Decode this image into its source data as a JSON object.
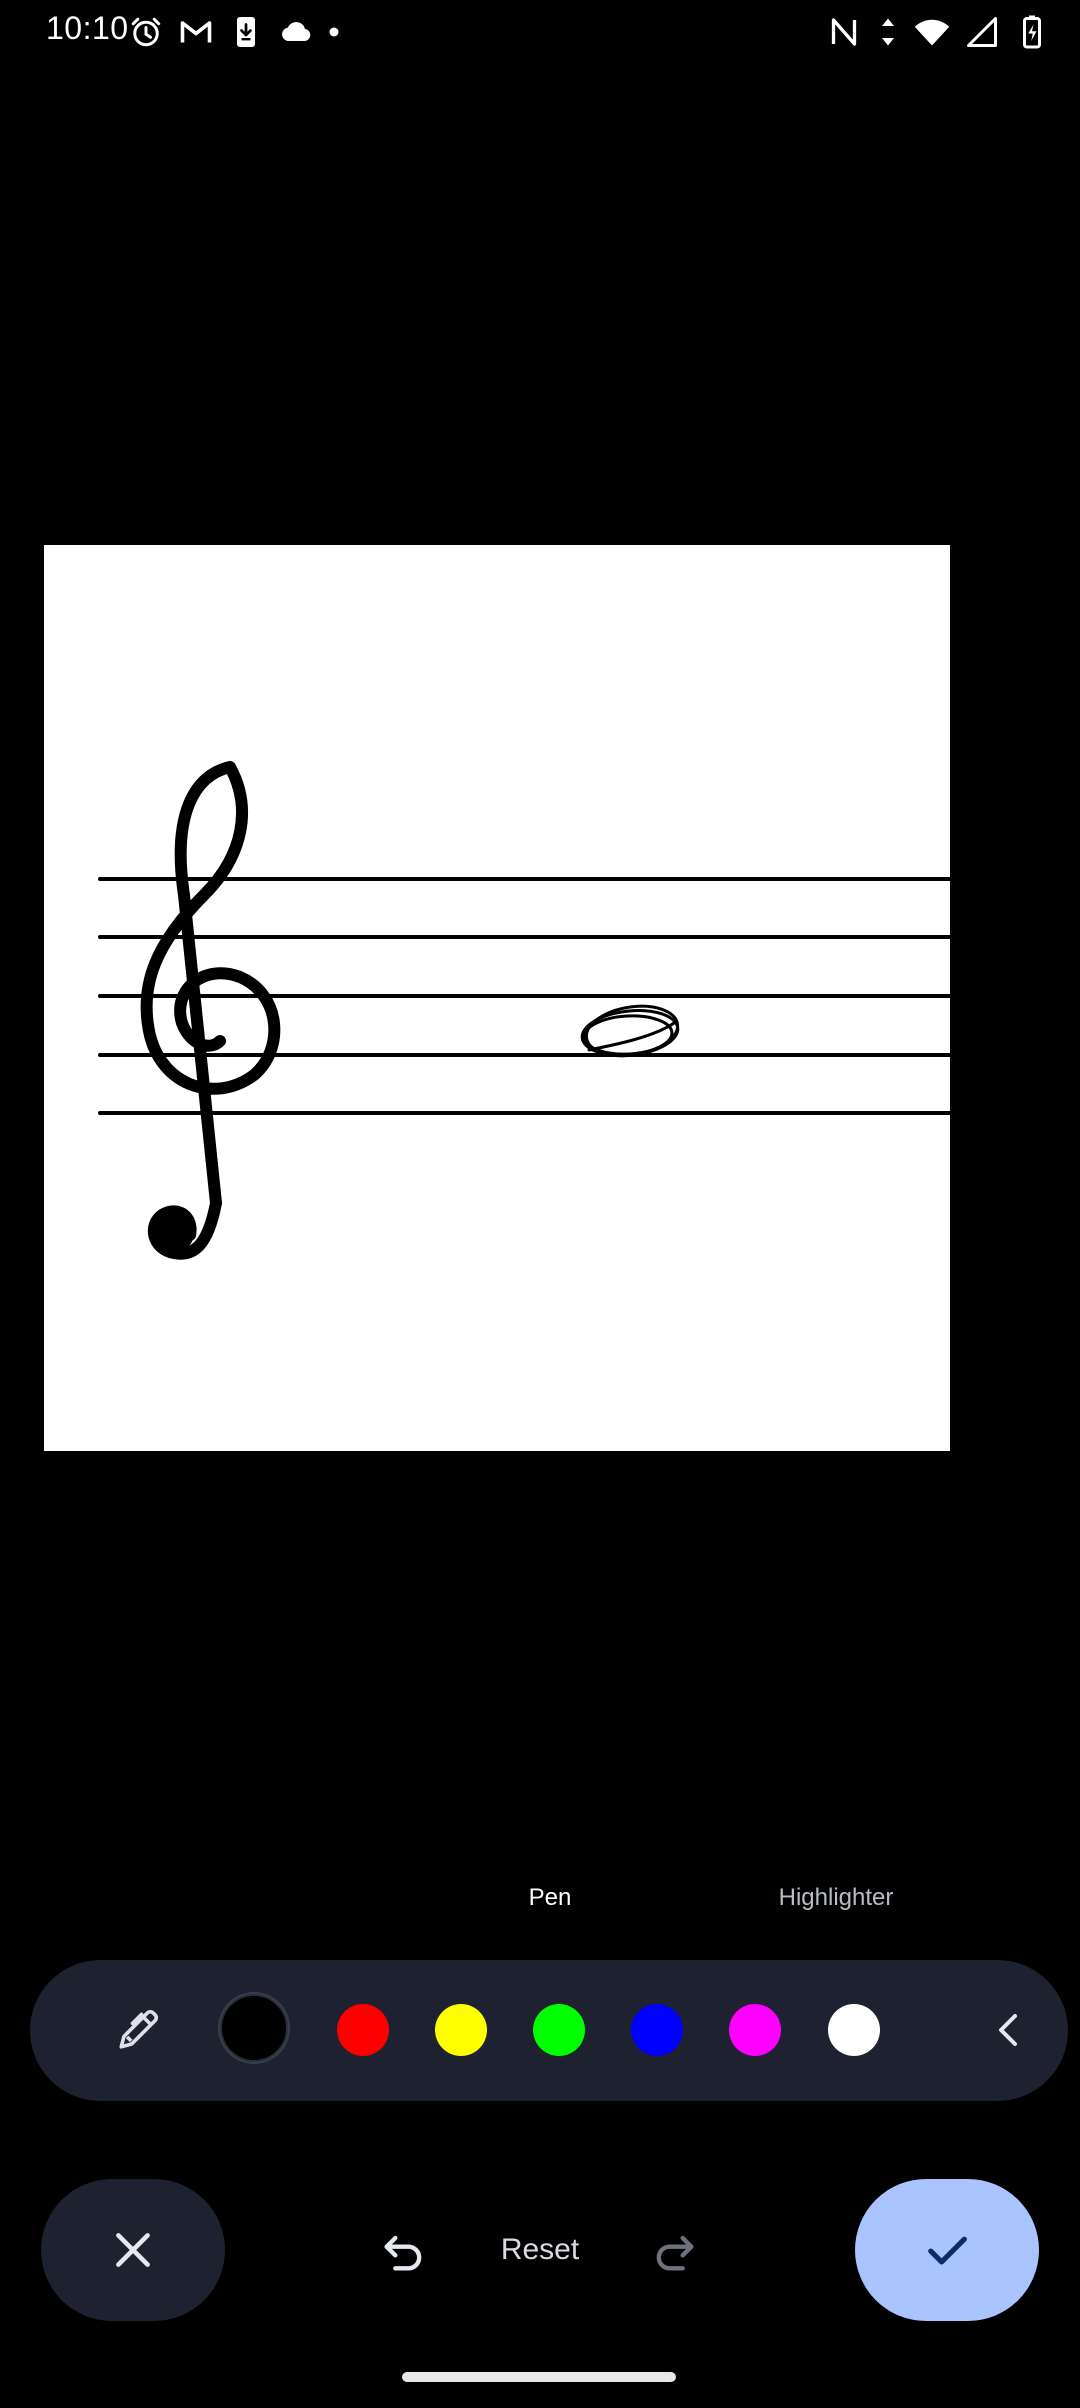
{
  "status_bar": {
    "time": "10:10",
    "left_icons": [
      "alarm-icon",
      "gmail-icon",
      "download-icon",
      "cloud-icon",
      "dot-icon"
    ],
    "right_icons": [
      "nfc-icon",
      "data-arrows-icon",
      "wifi-icon",
      "signal-icon",
      "battery-charging-icon"
    ]
  },
  "canvas": {
    "background": "#ffffff",
    "content": [
      "treble-clef-icon",
      "staff-lines",
      "hand-drawn-note"
    ]
  },
  "tool_modes": {
    "pen_label": "Pen",
    "highlighter_label": "Highlighter",
    "selected": "Pen"
  },
  "palette": {
    "tool_icon": "pen-icon",
    "colors": [
      {
        "name": "black",
        "hex": "#000000",
        "selected": true
      },
      {
        "name": "red",
        "hex": "#ff0000",
        "selected": false
      },
      {
        "name": "yellow",
        "hex": "#ffff00",
        "selected": false
      },
      {
        "name": "green",
        "hex": "#00ff00",
        "selected": false
      },
      {
        "name": "blue",
        "hex": "#0000ff",
        "selected": false
      },
      {
        "name": "magenta",
        "hex": "#ff00ff",
        "selected": false
      },
      {
        "name": "white",
        "hex": "#ffffff",
        "selected": false
      }
    ],
    "collapse_icon": "chevron-left-icon",
    "background": "#1e2130"
  },
  "actions": {
    "cancel_icon": "close-icon",
    "undo_icon": "undo-icon",
    "reset_label": "Reset",
    "redo_icon": "redo-icon",
    "confirm_icon": "check-icon",
    "confirm_color": "#a9c4ff"
  }
}
